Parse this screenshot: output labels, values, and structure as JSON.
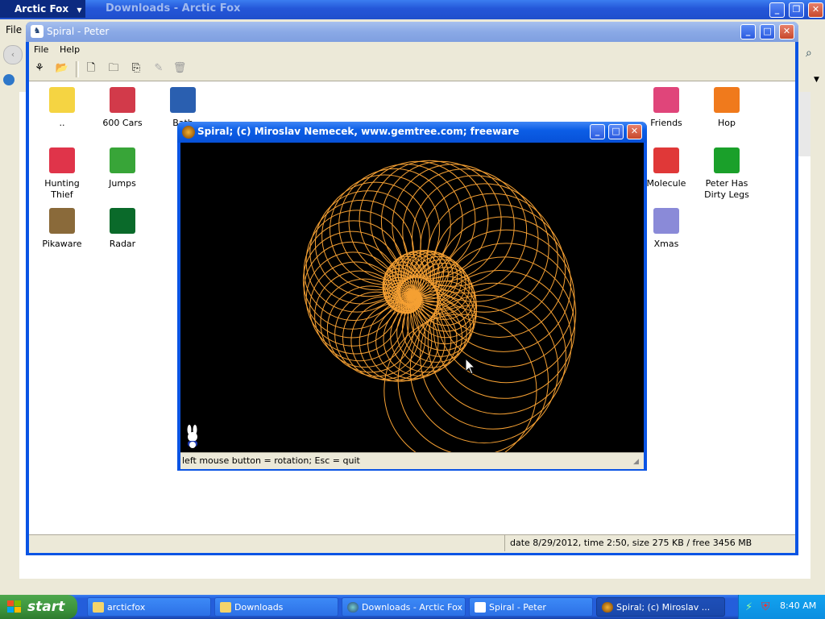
{
  "browser": {
    "app_menu": "Arctic Fox",
    "title": "Downloads - Arctic Fox",
    "menu_file": "File"
  },
  "peter": {
    "title": "Spiral - Peter",
    "menu": {
      "file": "File",
      "help": "Help"
    },
    "status": "date 8/29/2012, time 2:50, size 275 KB / free 3456 MB",
    "items": [
      {
        "label": "..",
        "icon": "folder-up-icon",
        "color": "#f5d442"
      },
      {
        "label": "600 Cars",
        "icon": "car-icon",
        "color": "#d23a4a"
      },
      {
        "label": "Bath",
        "icon": "bath-icon",
        "color": "#2a5fb0"
      },
      {
        "label": "Friends",
        "icon": "house-icon",
        "color": "#e0457a"
      },
      {
        "label": "Hop",
        "icon": "bunny-icon",
        "color": "#f07a1c"
      },
      {
        "label": "Hunting Thief",
        "icon": "thief-icon",
        "color": "#e0344a"
      },
      {
        "label": "Jumps",
        "icon": "bunny-icon",
        "color": "#38a538"
      },
      {
        "label": "Molecule",
        "icon": "molecule-icon",
        "color": "#e03838"
      },
      {
        "label": "Peter Has\nDirty Legs",
        "icon": "flower-icon",
        "color": "#1aa02a"
      },
      {
        "label": "Pikaware",
        "icon": "pikaware-icon",
        "color": "#8a6a3a"
      },
      {
        "label": "Radar",
        "icon": "radar-icon",
        "color": "#0a6a2a"
      },
      {
        "label": "Xmas",
        "icon": "snowman-icon",
        "color": "#8a8ad8"
      }
    ]
  },
  "spiral": {
    "title": "Spiral;   (c) Miroslav Nemecek, www.gemtree.com;   freeware",
    "status": "left mouse button = rotation;   Esc = quit",
    "curve_color": "#f5a033"
  },
  "taskbar": {
    "start": "start",
    "tasks": [
      "arcticfox",
      "Downloads",
      "Downloads - Arctic Fox",
      "Spiral - Peter",
      "Spiral;   (c) Miroslav ..."
    ],
    "clock": "8:40 AM"
  }
}
